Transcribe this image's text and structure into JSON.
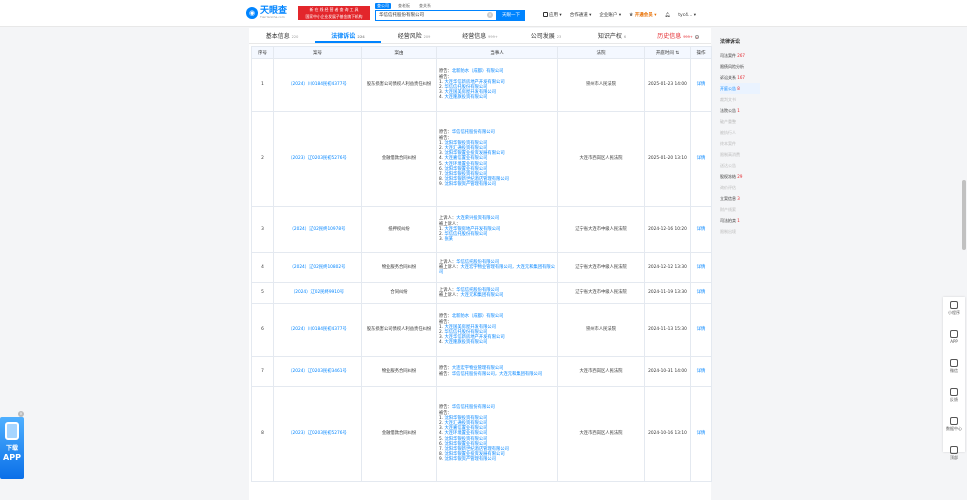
{
  "header": {
    "logo_text": "天眼查",
    "logo_sub": "TianYanCha.com",
    "badge_line1": "国家中小企业发展子基金旗下机构",
    "badge_line2": "新 在 线 经 营 者 查 询 工 具",
    "search_tabs": [
      "查公司",
      "查老板",
      "查关系"
    ],
    "search_value": "华信信托股份有限公司",
    "search_button": "天眼一下",
    "nav": [
      "应用",
      "合作通道",
      "企业账户",
      "开通会员",
      "tyc4..."
    ]
  },
  "tabs": [
    {
      "label": "基本信息",
      "count": "220"
    },
    {
      "label": "法律诉讼",
      "count": "224"
    },
    {
      "label": "经营风险",
      "count": "209"
    },
    {
      "label": "经营信息",
      "count": "999+"
    },
    {
      "label": "公司发展",
      "count": "23"
    },
    {
      "label": "知识产权",
      "count": "6"
    },
    {
      "label": "历史信息",
      "count": "999+"
    }
  ],
  "table": {
    "headers": [
      "序号",
      "案号",
      "案由",
      "当事人",
      "法院",
      "开庭时间",
      "操作"
    ],
    "detail_label": "详情",
    "rows": [
      {
        "no": "1",
        "case_no": "（2024）川0184民初4377号",
        "cause": "股东损害公司债权人利益责任纠纷",
        "parties": [
          {
            "role": "原告：",
            "name": "北新防水（成都）有限公司"
          },
          {
            "role": "被告：",
            "name": ""
          },
          {
            "role": "1. ",
            "name": "大连华信新房地产开发有限公司"
          },
          {
            "role": "2. ",
            "name": "华信信托股份有限公司"
          },
          {
            "role": "3. ",
            "name": "大连国美房屋开发有限公司"
          },
          {
            "role": "4. ",
            "name": "大连隆旗投资有限公司"
          }
        ],
        "court": "崇州市人民法院",
        "time": "2025-01-23 14:00"
      },
      {
        "no": "2",
        "case_no": "（2023）辽0203民初5276号",
        "cause": "金融借款合同纠纷",
        "parties": [
          {
            "role": "原告：",
            "name": "华信信托股份有限公司"
          },
          {
            "role": "被告：",
            "name": ""
          },
          {
            "role": "1. ",
            "name": "沈阳华银投资有限公司"
          },
          {
            "role": "2. ",
            "name": "大连汇通投资有限公司"
          },
          {
            "role": "3. ",
            "name": "沈阳华银置业投资发展有限公司"
          },
          {
            "role": "4. ",
            "name": "大连嘉信置业有限公司"
          },
          {
            "role": "5. ",
            "name": "大连环境置业有限公司"
          },
          {
            "role": "6. ",
            "name": "沈阳华银置业有限公司"
          },
          {
            "role": "7. ",
            "name": "沈阳华银投资有限公司"
          },
          {
            "role": "8. ",
            "name": "沈阳华银新世纪酒店管理有限公司"
          },
          {
            "role": "9. ",
            "name": "沈阳华银资产管理有限公司"
          }
        ],
        "court": "大连市西岗区人民法院",
        "time": "2025-01-20 13:10"
      },
      {
        "no": "3",
        "case_no": "（2024）辽02民终10978号",
        "cause": "抵押权纠纷",
        "parties": [
          {
            "role": "上诉人：",
            "name": "大连荣兴投资有限公司"
          },
          {
            "role": "被上诉人：",
            "name": ""
          },
          {
            "role": "1. ",
            "name": "大连华银房地产开发有限公司"
          },
          {
            "role": "2. ",
            "name": "华信信托股份有限公司"
          },
          {
            "role": "3. ",
            "name": "张某"
          }
        ],
        "court": "辽宁省大连市中级人民法院",
        "time": "2024-12-16 10:20"
      },
      {
        "no": "4",
        "case_no": "（2024）辽02民终10802号",
        "cause": "物业服务合同纠纷",
        "parties": [
          {
            "role": "上诉人：",
            "name": "华信信托股份有限公司"
          },
          {
            "role": "被上诉人：",
            "name": "大连宏宇物业管理有限公司，大连元和集团有限公司"
          }
        ],
        "court": "辽宁省大连市中级人民法院",
        "time": "2024-12-12 13:30"
      },
      {
        "no": "5",
        "case_no": "（2024）辽02民终9910号",
        "cause": "合同纠纷",
        "parties": [
          {
            "role": "上诉人：",
            "name": "华信信托股份有限公司"
          },
          {
            "role": "被上诉人：",
            "name": "大连元和集团有限公司"
          }
        ],
        "court": "辽宁省大连市中级人民法院",
        "time": "2024-11-19 13:30"
      },
      {
        "no": "6",
        "case_no": "（2024）川0184民初4377号",
        "cause": "股东损害公司债权人利益责任纠纷",
        "parties": [
          {
            "role": "原告：",
            "name": "北新防水（成都）有限公司"
          },
          {
            "role": "被告：",
            "name": ""
          },
          {
            "role": "1. ",
            "name": "大连国美房屋开发有限公司"
          },
          {
            "role": "2. ",
            "name": "华信信托股份有限公司"
          },
          {
            "role": "3. ",
            "name": "大连华信新房地产开发有限公司"
          },
          {
            "role": "4. ",
            "name": "大连隆旗投资有限公司"
          }
        ],
        "court": "崇州市人民法院",
        "time": "2024-11-13 15:30"
      },
      {
        "no": "7",
        "case_no": "（2024）辽0203民初3461号",
        "cause": "物业服务合同纠纷",
        "parties": [
          {
            "role": "原告：",
            "name": "大连宏宇物业管理有限公司"
          },
          {
            "role": "被告：",
            "name": "华信信托股份有限公司，大连元和集团有限公司"
          }
        ],
        "court": "大连市西岗区人民法院",
        "time": "2024-10-31 14:00"
      },
      {
        "no": "8",
        "case_no": "（2023）辽0203民初5276号",
        "cause": "金融借款合同纠纷",
        "parties": [
          {
            "role": "原告：",
            "name": "华信信托股份有限公司"
          },
          {
            "role": "被告：",
            "name": ""
          },
          {
            "role": "1. ",
            "name": "沈阳华银投资有限公司"
          },
          {
            "role": "2. ",
            "name": "大连汇通投资有限公司"
          },
          {
            "role": "3. ",
            "name": "大连嘉信置业有限公司"
          },
          {
            "role": "4. ",
            "name": "大连环境置业有限公司"
          },
          {
            "role": "5. ",
            "name": "沈阳华银投资有限公司"
          },
          {
            "role": "6. ",
            "name": "沈阳华银置业有限公司"
          },
          {
            "role": "7. ",
            "name": "沈阳华银新世纪酒店管理有限公司"
          },
          {
            "role": "8. ",
            "name": "沈阳华银置业投资发展有限公司"
          },
          {
            "role": "9. ",
            "name": "沈阳华银资产管理有限公司"
          }
        ],
        "court": "大连市西岗区人民法院",
        "time": "2024-10-16 13:10"
      }
    ]
  },
  "right_nav": {
    "title": "法律诉讼",
    "items": [
      {
        "label": "司法案件",
        "count": "267",
        "dim": false,
        "selected": false
      },
      {
        "label": "限债风险分析",
        "count": "",
        "dim": false,
        "selected": false
      },
      {
        "label": "诉讼关系",
        "count": "167",
        "dim": false,
        "selected": false
      },
      {
        "label": "开庭公告",
        "count": "8",
        "dim": false,
        "selected": true
      },
      {
        "label": "裁判文书",
        "count": "",
        "dim": true,
        "selected": false
      },
      {
        "label": "法院公告",
        "count": "1",
        "dim": false,
        "selected": false
      },
      {
        "label": "破产重整",
        "count": "",
        "dim": true,
        "selected": false
      },
      {
        "label": "被执行人",
        "count": "",
        "dim": true,
        "selected": false
      },
      {
        "label": "终本案件",
        "count": "",
        "dim": true,
        "selected": false
      },
      {
        "label": "限制高消费",
        "count": "",
        "dim": true,
        "selected": false
      },
      {
        "label": "送达公告",
        "count": "",
        "dim": true,
        "selected": false
      },
      {
        "label": "股权冻结",
        "count": "29",
        "dim": false,
        "selected": false
      },
      {
        "label": "询价评估",
        "count": "",
        "dim": true,
        "selected": false
      },
      {
        "label": "立案信息",
        "count": "3",
        "dim": false,
        "selected": false
      },
      {
        "label": "财产线索",
        "count": "",
        "dim": true,
        "selected": false
      },
      {
        "label": "司法拍卖",
        "count": "1",
        "dim": false,
        "selected": false
      },
      {
        "label": "限制出境",
        "count": "",
        "dim": true,
        "selected": false
      }
    ]
  },
  "sidebar": {
    "items": [
      {
        "label": "小程序",
        "icon": "mini-program-icon"
      },
      {
        "label": "APP",
        "icon": "phone-icon"
      },
      {
        "label": "微信",
        "icon": "wechat-icon"
      },
      {
        "label": "反馈",
        "icon": "feedback-icon"
      },
      {
        "label": "数据中心",
        "icon": "data-center-icon"
      },
      {
        "label": "顶部",
        "icon": "back-to-top-icon"
      }
    ]
  },
  "promo": {
    "line1": "下载",
    "line2": "APP"
  }
}
